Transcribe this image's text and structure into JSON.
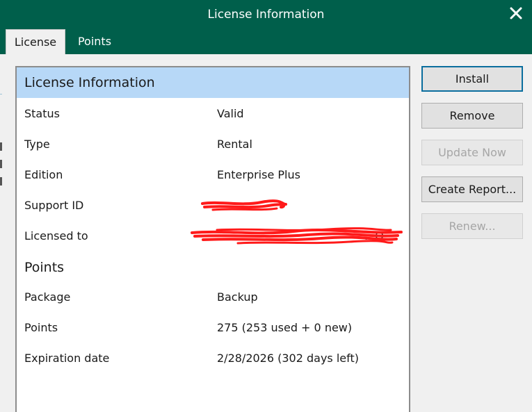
{
  "window": {
    "title": "License Information",
    "accent_color": "#005f4b"
  },
  "tabs": [
    {
      "label": "License",
      "active": true
    },
    {
      "label": "Points",
      "active": false
    }
  ],
  "panel": {
    "header": "License Information",
    "header_bg": "#b7d8f7",
    "license_rows": [
      {
        "label": "Status",
        "value": "Valid"
      },
      {
        "label": "Type",
        "value": "Rental"
      },
      {
        "label": "Edition",
        "value": "Enterprise Plus"
      },
      {
        "label": "Support ID",
        "value": ""
      },
      {
        "label": "Licensed to",
        "value": "...O..."
      }
    ],
    "points_title": "Points",
    "points_rows": [
      {
        "label": "Package",
        "value": "Backup"
      },
      {
        "label": "Points",
        "value": "275 (253 used + 0 new)"
      },
      {
        "label": "Expiration date",
        "value": "2/28/2026 (302 days left)"
      }
    ]
  },
  "buttons": {
    "install": "Install",
    "remove": "Remove",
    "update_now": "Update Now",
    "create_report": "Create Report...",
    "renew": "Renew..."
  },
  "icons": {
    "close": "close-icon"
  }
}
